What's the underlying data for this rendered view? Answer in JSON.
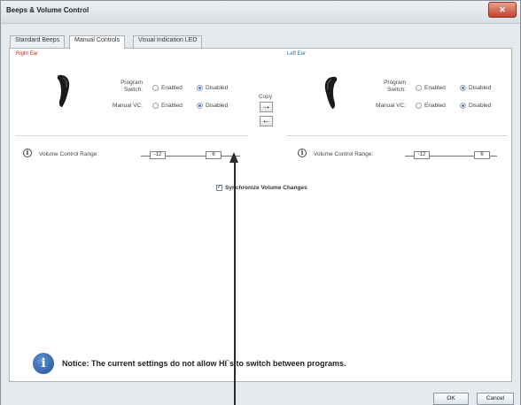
{
  "window": {
    "title": "Beeps & Volume Control",
    "close_glyph": "✕"
  },
  "tabs": [
    {
      "label": "Standard Beeps",
      "active": false
    },
    {
      "label": "Manual Controls",
      "active": true
    },
    {
      "label": "Visual Indication LED",
      "active": false
    }
  ],
  "right_ear": {
    "label": "Right Ear",
    "program_switch": {
      "label": "Program Switch:",
      "options": [
        "Enabled",
        "Disabled"
      ],
      "selected": "Disabled"
    },
    "manual_vc": {
      "label": "Manual VC:",
      "options": [
        "Enabled",
        "Disabled"
      ],
      "selected": "Disabled"
    },
    "volume_range": {
      "label": "Volume Control Range:",
      "min": "-12",
      "max": "6"
    }
  },
  "left_ear": {
    "label": "Left Ear",
    "program_switch": {
      "label": "Program Switch:",
      "options": [
        "Enabled",
        "Disabled"
      ],
      "selected": "Disabled"
    },
    "manual_vc": {
      "label": "Manual VC:",
      "options": [
        "Enabled",
        "Disabled"
      ],
      "selected": "Disabled"
    },
    "volume_range": {
      "label": "Volume Control Range:",
      "min": "-12",
      "max": "6"
    }
  },
  "copy": {
    "label": "Copy",
    "right_arrow": "→",
    "left_arrow": "←"
  },
  "sync": {
    "label": "Synchronize Volume Changes",
    "checked": true,
    "check_glyph": "✓"
  },
  "info_glyph": "i",
  "notice": {
    "text": "Notice: The current settings do not allow HI`s to switch between programs."
  },
  "buttons": {
    "ok": "OK",
    "cancel": "Cancel"
  },
  "colors": {
    "right_ear": "#d42a1f",
    "left_ear": "#2f6fb5",
    "notice_icon": "#2f63ad"
  }
}
